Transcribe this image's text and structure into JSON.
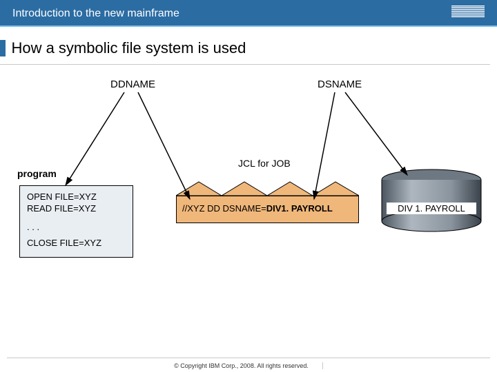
{
  "header": {
    "course": "Introduction to the new mainframe",
    "logo_name": "IBM"
  },
  "slide": {
    "title": "How a symbolic file system is used"
  },
  "diagram": {
    "ddname_label": "DDNAME",
    "dsname_label": "DSNAME",
    "program_label": "program",
    "jcl_label": "JCL for JOB",
    "program_box": {
      "line1": "OPEN FILE=XYZ",
      "line2": "READ FILE=XYZ",
      "line3": ". . .",
      "line4": "CLOSE FILE=XYZ"
    },
    "jcl_box": {
      "prefix": "//XYZ  DD  DSNAME=",
      "bold": "DIV1. PAYROLL"
    },
    "cylinder_label": "DIV 1. PAYROLL"
  },
  "footer": {
    "copyright": "© Copyright IBM Corp., 2008. All rights reserved."
  }
}
